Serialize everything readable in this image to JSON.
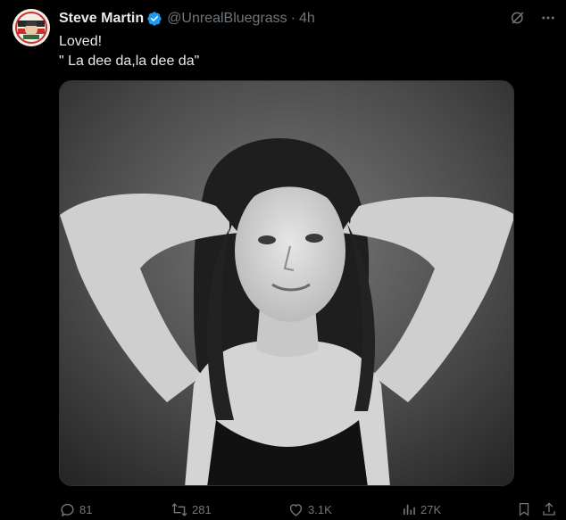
{
  "post": {
    "author": {
      "display_name": "Steve Martin",
      "handle": "@UnrealBluegrass",
      "verified": true,
      "avatar_icon": "avatar-image"
    },
    "separator": "·",
    "time": "4h",
    "text_lines": [
      "Loved!",
      "\" La dee da,la dee da\""
    ],
    "media": {
      "type": "photo",
      "style": "black-and-white"
    }
  },
  "top_actions": {
    "grok_icon": "grok-icon",
    "more_icon": "more-icon"
  },
  "actions": {
    "replies": "81",
    "reposts": "281",
    "likes": "3.1K",
    "views": "27K",
    "bookmark_icon": "bookmark-icon",
    "share_icon": "share-icon"
  },
  "colors": {
    "background": "#000000",
    "text": "#e7e9ea",
    "muted": "#71767b",
    "verified": "#1d9bf0",
    "border": "#2f3336"
  }
}
